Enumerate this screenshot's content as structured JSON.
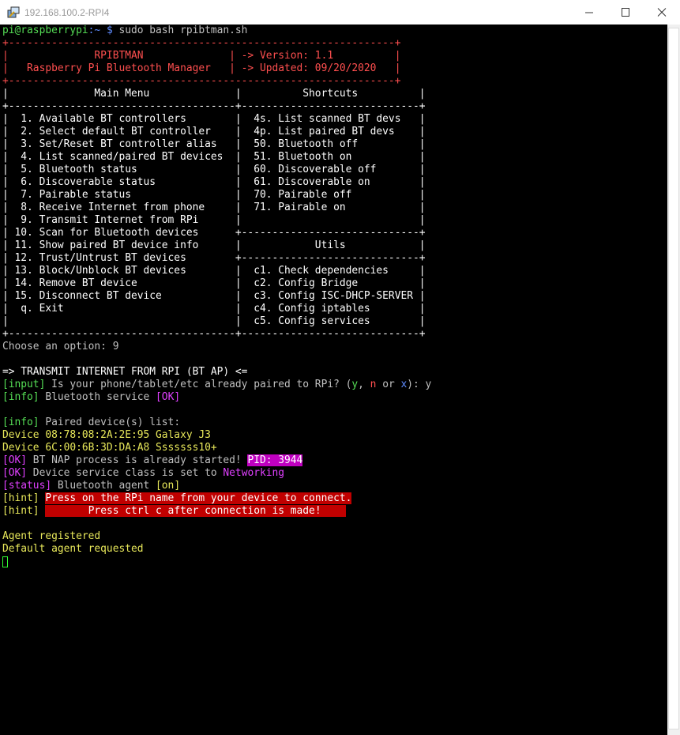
{
  "window": {
    "title": "192.168.100.2-RPI4"
  },
  "colors": {
    "green": "#55dd55",
    "blue": "#5f8cff",
    "red": "#ff4f4f",
    "yellow": "#e8e85a",
    "magenta": "#e040ff",
    "red_bg": "#c00000",
    "magenta_bg": "#c000c0"
  },
  "icons": {
    "app": "putty-icon",
    "minimize": "minimize-icon",
    "maximize": "maximize-icon",
    "close": "close-icon"
  },
  "prompt": {
    "user_host": "pi@raspberrypi",
    "path": ":~ $",
    "command": " sudo bash rpibtman.sh"
  },
  "banner": {
    "border": "+---------------------------------------------------------------+",
    "app_row": "|              RPIBTMAN              | -> Version: 1.1          |",
    "desc_row": "|   Raspberry Pi Bluetooth Manager   | -> Updated: 09/20/2020   |"
  },
  "menu": [
    "|              Main Menu              |          Shortcuts          |",
    "+-------------------------------------+-----------------------------+",
    "|  1. Available BT controllers        |  4s. List scanned BT devs   |",
    "|  2. Select default BT controller    |  4p. List paired BT devs    |",
    "|  3. Set/Reset BT controller alias   |  50. Bluetooth off          |",
    "|  4. List scanned/paired BT devices  |  51. Bluetooth on           |",
    "|  5. Bluetooth status                |  60. Discoverable off       |",
    "|  6. Discoverable status             |  61. Discoverable on        |",
    "|  7. Pairable status                 |  70. Pairable off           |",
    "|  8. Receive Internet from phone     |  71. Pairable on            |",
    "|  9. Transmit Internet from RPi      |                             |",
    "| 10. Scan for Bluetooth devices      +-----------------------------+",
    "| 11. Show paired BT device info      |            Utils            |",
    "| 12. Trust/Untrust BT devices        +-----------------------------+",
    "| 13. Block/Unblock BT devices        |  c1. Check dependencies     |",
    "| 14. Remove BT device                |  c2. Config Bridge          |",
    "| 15. Disconnect BT device            |  c3. Config ISC-DHCP-SERVER |",
    "|  q. Exit                            |  c4. Config iptables        |",
    "|                                     |  c5. Config services        |",
    "+-------------------------------------+-----------------------------+"
  ],
  "choose": "Choose an option: 9",
  "section_title": "=> TRANSMIT INTERNET FROM RPI (BT AP) <=",
  "input": {
    "tag": "[input]",
    "question": " Is your phone/tablet/etc already paired to RPi? (",
    "opt_y": "y",
    "sep1": ", ",
    "opt_n": "n",
    "sep2": " or ",
    "opt_x": "x",
    "end": "): y"
  },
  "bt_service": {
    "tag": "[info]",
    "text": " Bluetooth service ",
    "status": "[OK]"
  },
  "paired": {
    "tag": "[info]",
    "text": " Paired device(s) list:"
  },
  "devices": [
    "Device 08:78:08:2A:2E:95 Galaxy J3",
    "Device 6C:00:6B:3D:DA:A8 Sssssss10+"
  ],
  "nap": {
    "tag": "[OK]",
    "text": " BT NAP process is already started! ",
    "pid": "PID: 3944"
  },
  "class": {
    "tag": "[OK]",
    "text": " Device service class is set to ",
    "value": "Networking"
  },
  "agent_status": {
    "tag": "[status]",
    "text": " Bluetooth agent ",
    "value": "[on]"
  },
  "hint1": {
    "tag": "[hint]",
    "text": "Press on the RPi name from your device to connect."
  },
  "hint2": {
    "tag": "[hint]",
    "text": "       Press ctrl c after connection is made!"
  },
  "agent_registered": "Agent registered",
  "agent_requested": "Default agent requested"
}
